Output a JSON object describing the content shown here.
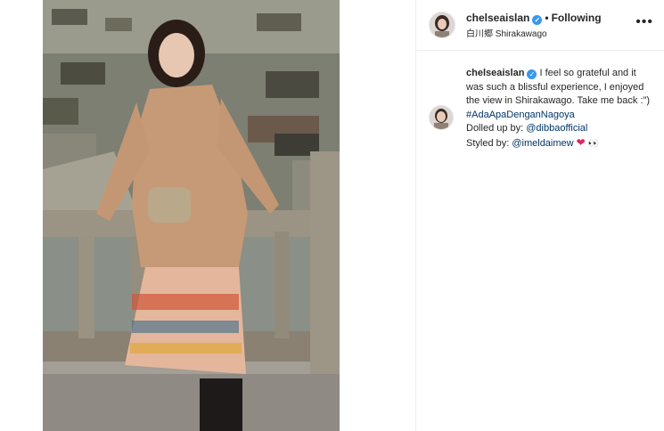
{
  "post_header": {
    "username": "chelseaislan",
    "verified_glyph": "✓",
    "separator": "•",
    "follow_status": "Following",
    "location": "白川郷 Shirakawago",
    "more_options": "•••"
  },
  "caption": {
    "username": "chelseaislan",
    "text_1": "I feel so grateful and it was such a blissful experience, I enjoyed the view in Shirakawago. Take me back :\") ",
    "hashtag": "#AdaApaDenganNagoya",
    "dolled_prefix": "Dolled up by: ",
    "dolled_mention": "@dibbaofficial",
    "styled_prefix": "Styled by: ",
    "styled_mention": "@imeldaimew",
    "emoji_heart": "❤",
    "emoji_eyes": "👀"
  },
  "icons": {
    "verified": "verified-badge-icon",
    "more": "more-options-icon"
  },
  "colors": {
    "verified": "#3897f0",
    "link": "#003569",
    "heart": "#e0245e",
    "text": "#262626",
    "divider": "#efefef"
  }
}
